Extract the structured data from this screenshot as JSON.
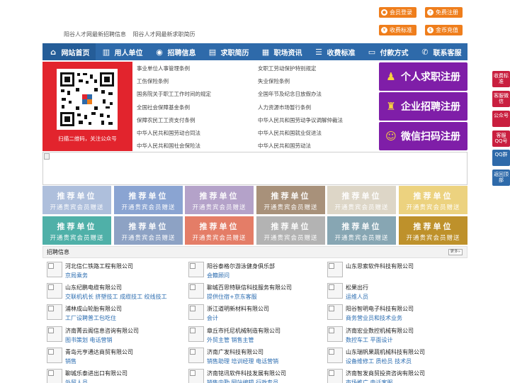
{
  "header": {
    "seo_links": [
      "阳谷人才网最新招聘信息",
      "阳谷人才网最新求职简历"
    ],
    "top_buttons": [
      {
        "label": "会员登录",
        "icon": "user-icon"
      },
      {
        "label": "免费注册",
        "icon": "register-icon"
      },
      {
        "label": "收费标准",
        "icon": "price-icon"
      },
      {
        "label": "金币充值",
        "icon": "coin-icon"
      }
    ]
  },
  "nav": [
    {
      "label": "网站首页",
      "icon": "home-icon"
    },
    {
      "label": "用人单位",
      "icon": "building-icon"
    },
    {
      "label": "招聘信息",
      "icon": "recruit-icon"
    },
    {
      "label": "求职简历",
      "icon": "resume-icon"
    },
    {
      "label": "职场资讯",
      "icon": "news-icon"
    },
    {
      "label": "收费标准",
      "icon": "price-icon"
    },
    {
      "label": "付款方式",
      "icon": "card-icon"
    },
    {
      "label": "联系客服",
      "icon": "phone-icon"
    }
  ],
  "qr": {
    "caption": "扫描二维码，关注公众号"
  },
  "news_left": [
    "事业单位人事管理条例",
    "工伤保险条例",
    "国务院关于职工工作时间的规定",
    "全国社会保障基金条例",
    "保障农民工工资支付条例",
    "中华人民共和国劳动合同法",
    "中华人民共和国社会保险法"
  ],
  "news_right": [
    "女职工劳动保护特别规定",
    "失业保险条例",
    "全国年节及纪念日放假办法",
    "人力资源市场暂行条例",
    "中华人民共和国劳动争议调解仲裁法",
    "中华人民共和国就业促进法",
    "中华人民共和国劳动法"
  ],
  "register_buttons": [
    {
      "label": "个人求职注册",
      "icon": "person-icon"
    },
    {
      "label": "企业招聘注册",
      "icon": "company-icon"
    },
    {
      "label": "微信扫码注册",
      "icon": "wechat-icon"
    }
  ],
  "ad_tiles": {
    "title": "推荐单位",
    "subtitle": "开通贵宾会员赠送",
    "colors": [
      "#aebfdc",
      "#8aa4d2",
      "#b4a2c9",
      "#a8917a",
      "#ddd6c7",
      "#ecd27f",
      "#4fb0a8",
      "#8da2c4",
      "#e47d67",
      "#b3b3b3",
      "#87a6b3",
      "#be912b"
    ]
  },
  "jobs": {
    "title": "招聘信息",
    "more": "更多»",
    "columns": [
      [
        {
          "company": "河北信仁铁路工程有限公司",
          "positions": "京局乘务"
        },
        {
          "company": "山东纪鹏电缆有限公司",
          "positions": "交联机机长 挤塑技工 成缆技工 绞线技工"
        },
        {
          "company": "浦林成山轮胎有限公司",
          "positions": "工厂设聘普工包吃住"
        },
        {
          "company": "济南菁云阁信息咨询有限公司",
          "positions": "图书策划 电话营销"
        },
        {
          "company": "青岛元亨通达商贸有限公司",
          "positions": "销售"
        },
        {
          "company": "聊城乐泰进出口有限公司",
          "positions": "外贸人员"
        }
      ],
      [
        {
          "company": "阳谷泰格尔游泳健身俱乐部",
          "positions": "会籍顾问"
        },
        {
          "company": "聊城百思特联信科技服务有限公司",
          "positions": "提供住宿+京东客服"
        },
        {
          "company": "浙江道明新材料有限公司",
          "positions": "会计"
        },
        {
          "company": "章丘市托尼机械制造有限公司",
          "positions": "外贸主管 销售主管"
        },
        {
          "company": "济南广发科技有限公司",
          "positions": "销售助理 培训经理 电话营销"
        },
        {
          "company": "济南铭讯软件科技发展有限公司",
          "positions": "销售内勤 网站编辑 行政专员"
        }
      ],
      [
        {
          "company": "山东思索软件科技有限公司",
          "positions": ""
        },
        {
          "company": "松果出行",
          "positions": "运维人员"
        },
        {
          "company": "阳谷智明电子科技有限公司",
          "positions": "商务营业员和技术业务"
        },
        {
          "company": "济南宏业数控机械有限公司",
          "positions": "数控车工 平面设计"
        },
        {
          "company": "山东瑞帆果蔬机械科技有限公司",
          "positions": "设备维修工 质检员 技术员"
        },
        {
          "company": "济南智发商贸投资咨询有限公司",
          "positions": "市场推广 电话客服"
        }
      ]
    ]
  },
  "sidebar": [
    "收费标准",
    "客服微信",
    "公众号",
    "客服QQ号",
    "QQ群",
    "返回顶部"
  ]
}
